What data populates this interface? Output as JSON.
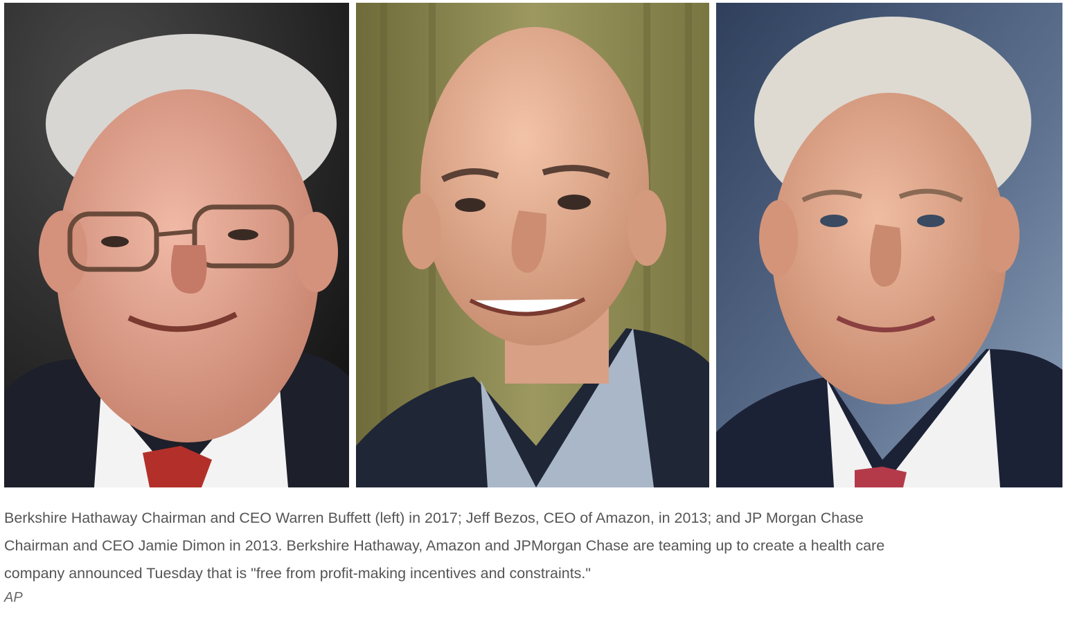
{
  "photos": [
    {
      "name": "photo-left",
      "icon": "portrait-photo"
    },
    {
      "name": "photo-middle",
      "icon": "portrait-photo"
    },
    {
      "name": "photo-right",
      "icon": "portrait-photo"
    }
  ],
  "caption": {
    "text": "Berkshire Hathaway Chairman and CEO Warren Buffett (left) in 2017; Jeff Bezos, CEO of Amazon, in 2013; and JP Morgan Chase Chairman and CEO Jamie Dimon in 2013. Berkshire Hathaway, Amazon and JPMorgan Chase are teaming up to create a health care company announced Tuesday that is \"free from profit-making incentives and constraints.\"",
    "credit": "AP"
  },
  "colors": {
    "caption_text": "#555555",
    "credit_text": "#666666",
    "left_background": "#2a2a2a",
    "middle_background": "#8c8a52",
    "right_background": "#3b4f6e"
  }
}
